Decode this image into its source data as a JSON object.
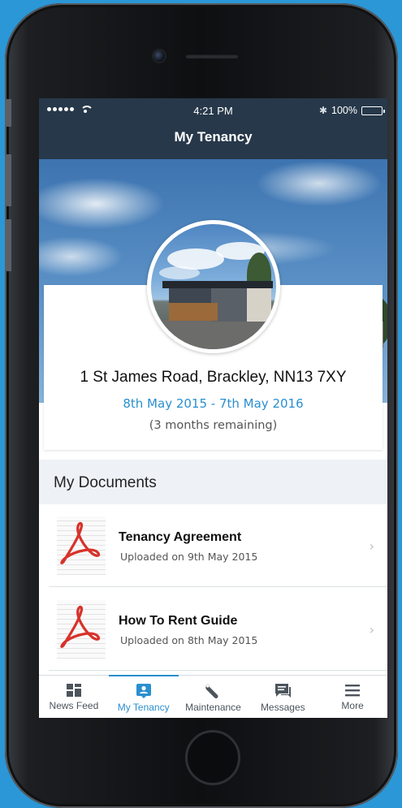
{
  "status_bar": {
    "time": "4:21 PM",
    "battery_text": "100%",
    "bluetooth_icon": "bluetooth-icon"
  },
  "nav": {
    "title": "My Tenancy"
  },
  "tenancy": {
    "address": "1 St James Road, Brackley, NN13 7XY",
    "dates": "8th May 2015 - 7th May 2016",
    "remaining": "(3 months remaining)"
  },
  "documents": {
    "header": "My Documents",
    "items": [
      {
        "title": "Tenancy Agreement",
        "subtitle": "Uploaded on 9th May 2015",
        "icon": "pdf-icon"
      },
      {
        "title": "How To Rent Guide",
        "subtitle": "Uploaded on 8th May 2015",
        "icon": "pdf-icon"
      }
    ]
  },
  "tabs": [
    {
      "label": "News Feed",
      "icon": "news-feed-icon",
      "active": false
    },
    {
      "label": "My Tenancy",
      "icon": "tenant-badge-icon",
      "active": true
    },
    {
      "label": "Maintenance",
      "icon": "wrench-icon",
      "active": false
    },
    {
      "label": "Messages",
      "icon": "chat-icon",
      "active": false
    },
    {
      "label": "More",
      "icon": "menu-icon",
      "active": false
    }
  ],
  "colors": {
    "background": "#2b97d6",
    "nav_bar": "#27384a",
    "accent": "#2a8fcf",
    "pdf_red": "#d7322a"
  }
}
